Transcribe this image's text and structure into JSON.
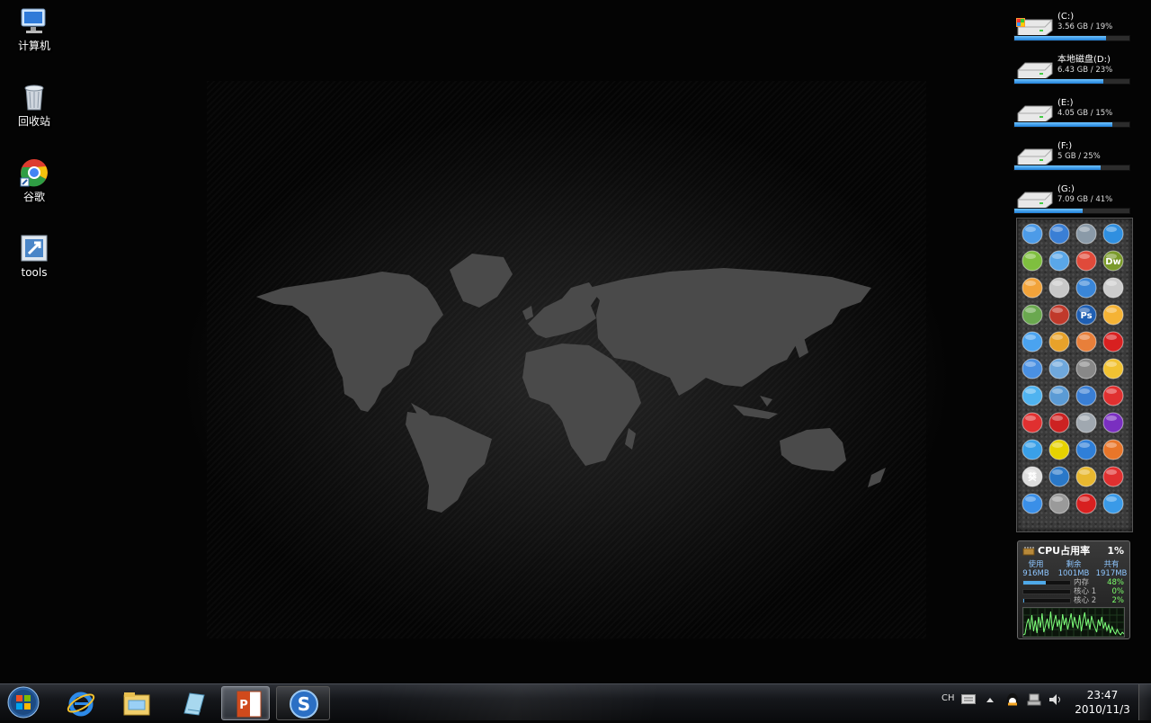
{
  "desktop_icons": [
    {
      "label": "计算机",
      "icon": "computer-icon"
    },
    {
      "label": "回收站",
      "icon": "recycle-bin-icon"
    },
    {
      "label": "谷歌",
      "icon": "chrome-icon"
    },
    {
      "label": "tools",
      "icon": "shortcut-icon"
    }
  ],
  "drives": [
    {
      "name": "(C:)",
      "size": "3.56 GB / 19%",
      "usage_pct": 19,
      "fill_fraction": 0.8
    },
    {
      "name": "本地磁盘(D:)",
      "size": "6.43 GB / 23%",
      "usage_pct": 23,
      "fill_fraction": 0.77
    },
    {
      "name": "(E:)",
      "size": "4.05 GB / 15%",
      "usage_pct": 15,
      "fill_fraction": 0.85
    },
    {
      "name": "(F:)",
      "size": "5 GB / 25%",
      "usage_pct": 25,
      "fill_fraction": 0.75
    },
    {
      "name": "(G:)",
      "size": "7.09 GB / 41%",
      "usage_pct": 41,
      "fill_fraction": 0.59
    }
  ],
  "launcher": {
    "icons": [
      "control-panel-icon",
      "ie-icon",
      "recycle-icon",
      "security-shield-icon",
      "package-icon",
      "monitor-icon",
      "eye-icon",
      "dreamweaver-icon",
      "media-icon",
      "window-icon",
      "bird-icon",
      "portrait-icon",
      "pin-icon",
      "help-icon",
      "photoshop-icon",
      "chat-icon",
      "qq-icon",
      "qq-penguin-icon",
      "java-icon",
      "opera-icon",
      "msn-icon",
      "network-icon",
      "pen-icon",
      "ball-icon",
      "butterfly-icon",
      "folder-icon",
      "star-burst-icon",
      "red-splat-icon",
      "red-splat-icon",
      "game-icon",
      "remote-desktop-icon",
      "media-player-icon",
      "gear-icon",
      "radiation-icon",
      "sogou-icon",
      "firefox-icon",
      "kui-icon",
      "chart-icon",
      "star-icon",
      "red-splat-icon",
      "thunder-icon",
      "settings-icon",
      "m-icon",
      "browser-icon"
    ],
    "glyph_dw": "Dw",
    "glyph_ps": "Ps",
    "glyph_kui": "葵"
  },
  "cpu_gadget": {
    "title": "CPU占用率",
    "value": "1%",
    "headers": [
      "使用",
      "剩余",
      "共有"
    ],
    "mem_values": [
      "916MB",
      "1001MB",
      "1917MB"
    ],
    "rows": [
      {
        "label": "内存",
        "value": "48%",
        "fraction": 0.48
      },
      {
        "label": "核心 1",
        "value": "0%",
        "fraction": 0.0
      },
      {
        "label": "核心 2",
        "value": "2%",
        "fraction": 0.02
      }
    ],
    "graph_samples": [
      2,
      3,
      14,
      20,
      8,
      24,
      6,
      18,
      4,
      22,
      10,
      26,
      5,
      12,
      20,
      9,
      28,
      7,
      16,
      24,
      11,
      19,
      6,
      25,
      13,
      21,
      8,
      17,
      26,
      10,
      22,
      14,
      9,
      24,
      6,
      18,
      27,
      12,
      20,
      8,
      23,
      15,
      10,
      5,
      19,
      12,
      22,
      9,
      16,
      7,
      13,
      4,
      11,
      6,
      3,
      8,
      4,
      2,
      5,
      3
    ]
  },
  "taskbar": {
    "apps": [
      "start-orb",
      "ie-icon",
      "explorer-icon",
      "notes-icon",
      "powerpoint-icon",
      "sogou-icon"
    ],
    "tray_lang": "CH",
    "time": "23:47",
    "date": "2010/11/3"
  }
}
